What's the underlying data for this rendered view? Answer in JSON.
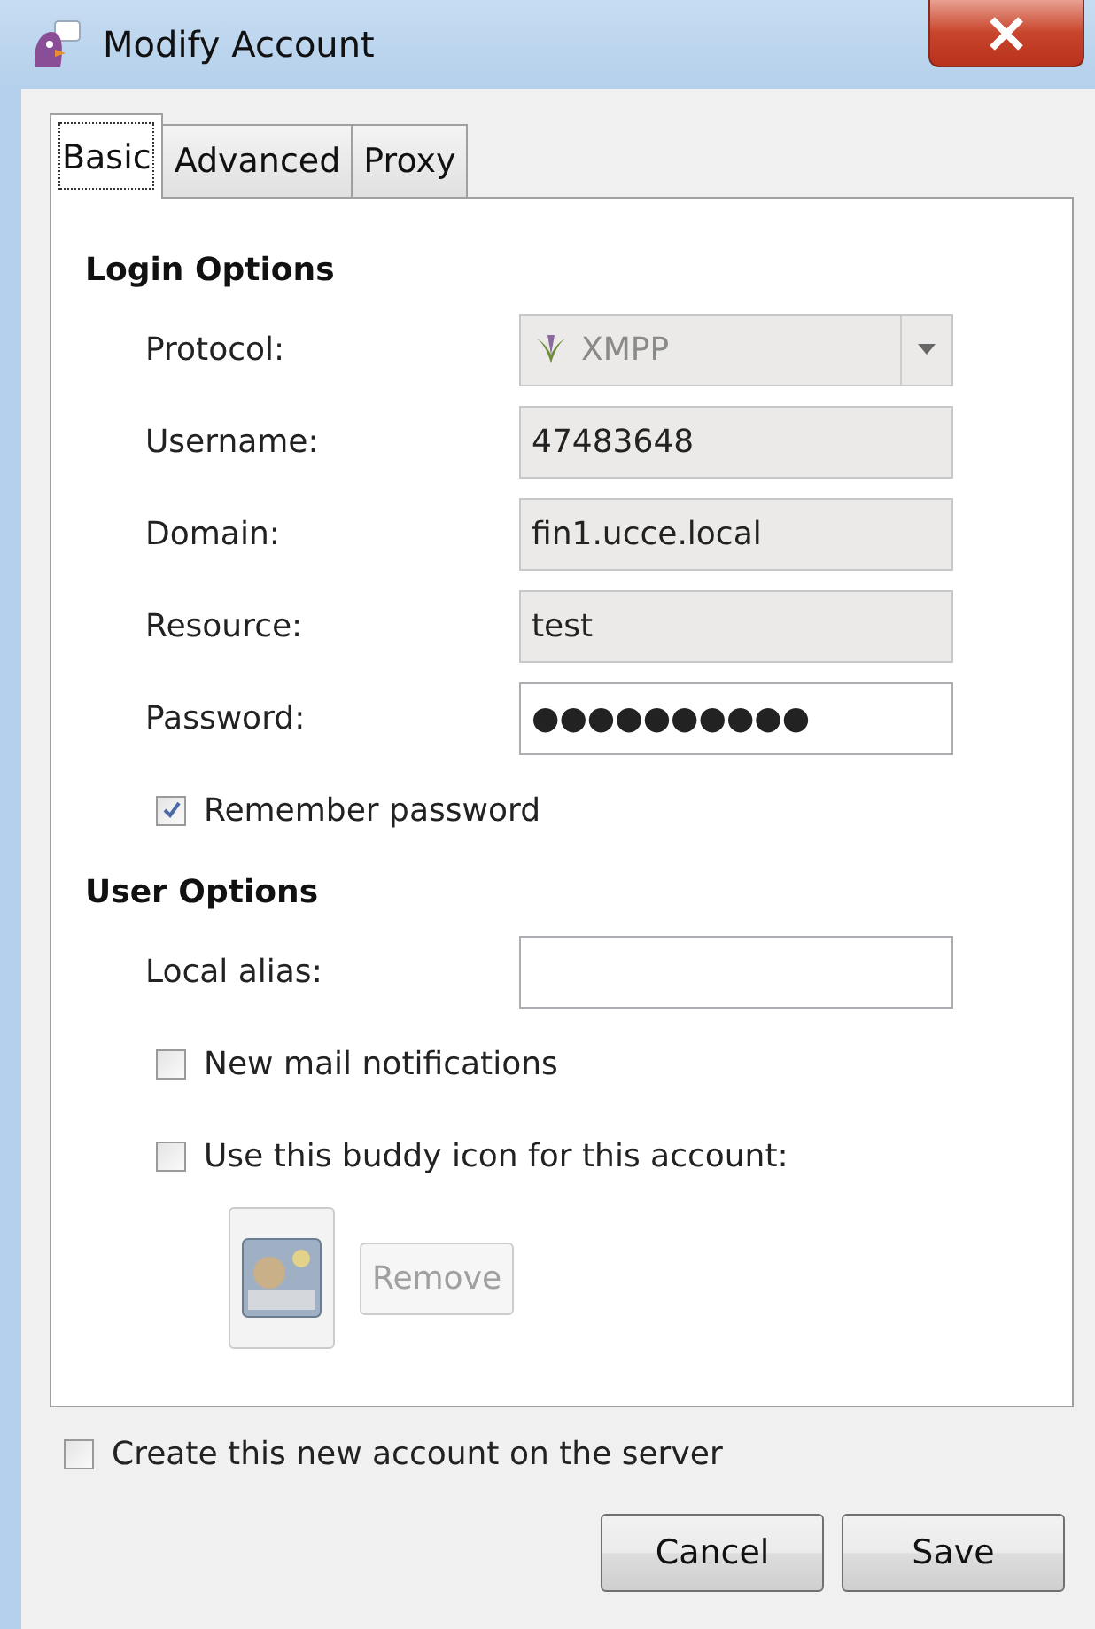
{
  "window": {
    "title": "Modify Account"
  },
  "tabs": [
    {
      "label": "Basic",
      "selected": true
    },
    {
      "label": "Advanced",
      "selected": false
    },
    {
      "label": "Proxy",
      "selected": false
    }
  ],
  "sections": [
    {
      "title": "Login Options",
      "rows": [
        {
          "kind": "select",
          "label": "Protocol:",
          "value": "XMPP",
          "disabled": true
        },
        {
          "kind": "field",
          "label": "Username:",
          "value": "47483648",
          "disabled": true
        },
        {
          "kind": "field",
          "label": "Domain:",
          "value": "fin1.ucce.local",
          "disabled": true
        },
        {
          "kind": "field",
          "label": "Resource:",
          "value": "test",
          "disabled": true
        },
        {
          "kind": "field",
          "label": "Password:",
          "value": "●●●●●●●●●●",
          "disabled": false
        },
        {
          "kind": "checkbox",
          "label": "Remember password",
          "checked": true
        }
      ]
    },
    {
      "title": "User Options",
      "rows": [
        {
          "kind": "field",
          "label": "Local alias:",
          "disabled": false
        },
        {
          "kind": "checkbox",
          "label": "New mail notifications",
          "checked": false
        },
        {
          "kind": "checkbox",
          "label": "Use this buddy icon for this account:",
          "checked": false
        },
        {
          "kind": "buddy",
          "button": {
            "label": "Remove",
            "disabled": true
          }
        }
      ]
    }
  ],
  "footer": {
    "checkbox": {
      "label": "Create this new account on the server",
      "checked": false
    },
    "buttons": [
      {
        "label": "Cancel"
      },
      {
        "label": "Save"
      }
    ]
  }
}
